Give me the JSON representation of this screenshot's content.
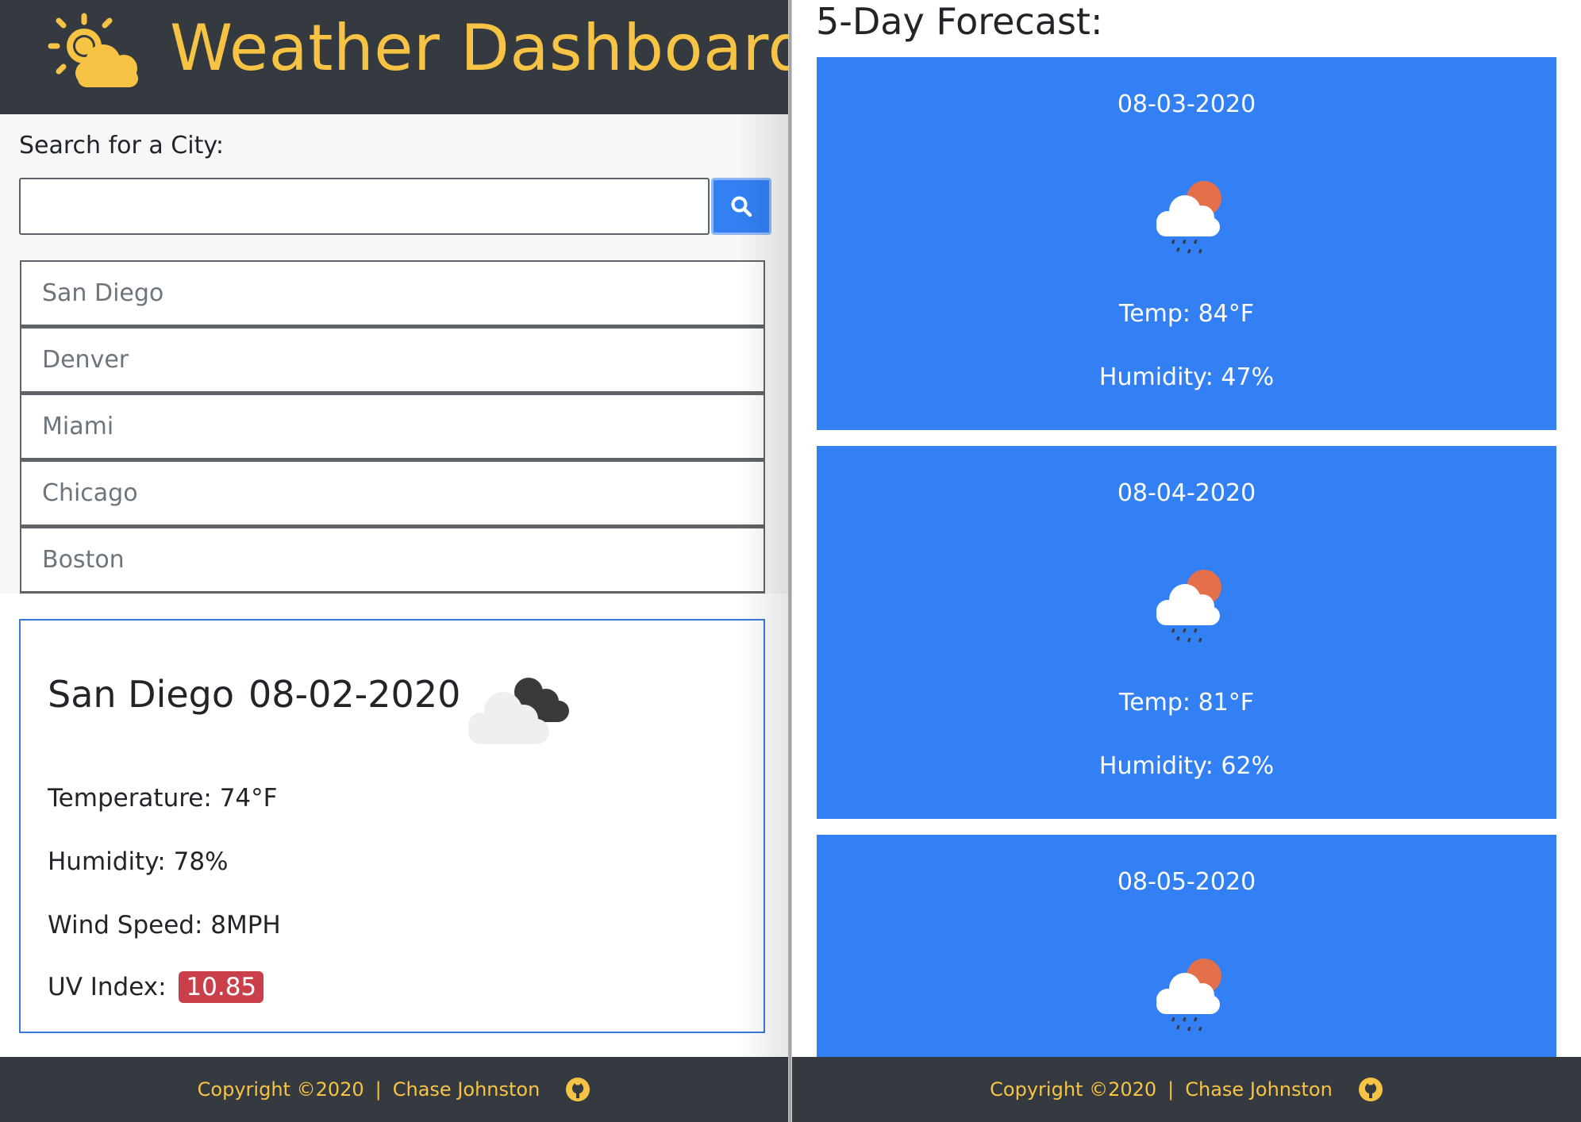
{
  "header": {
    "title": "Weather Dashboard",
    "logo_icon": "sun-cloud-icon"
  },
  "search": {
    "label": "Search for a City:",
    "value": "",
    "placeholder": "",
    "button_icon": "search-icon"
  },
  "history": [
    "San Diego",
    "Denver",
    "Miami",
    "Chicago",
    "Boston"
  ],
  "current": {
    "city": "San Diego",
    "date": "08-02-2020",
    "icon": "broken-clouds-icon",
    "temperature_label": "Temperature:",
    "temperature": "74°F",
    "humidity_label": "Humidity:",
    "humidity": "78%",
    "wind_label": "Wind Speed:",
    "wind": "8MPH",
    "uv_label": "UV Index:",
    "uv": "10.85"
  },
  "forecast": {
    "title": "5-Day Forecast:",
    "days": [
      {
        "date": "08-03-2020",
        "icon": "rain-sun-icon",
        "temp": "Temp: 84°F",
        "humidity": "Humidity: 47%"
      },
      {
        "date": "08-04-2020",
        "icon": "rain-sun-icon",
        "temp": "Temp: 81°F",
        "humidity": "Humidity: 62%"
      },
      {
        "date": "08-05-2020",
        "icon": "rain-sun-icon",
        "temp": "",
        "humidity": ""
      }
    ]
  },
  "footer": {
    "copyright": "Copyright ©2020",
    "separator": "|",
    "author": "Chase Johnston",
    "github_icon": "github-icon"
  },
  "colors": {
    "header_bg": "#343a40",
    "accent_yellow": "#f6c344",
    "card_blue": "#3280f3",
    "uv_red": "#c9404b",
    "panel_border": "#3a7ad9"
  }
}
